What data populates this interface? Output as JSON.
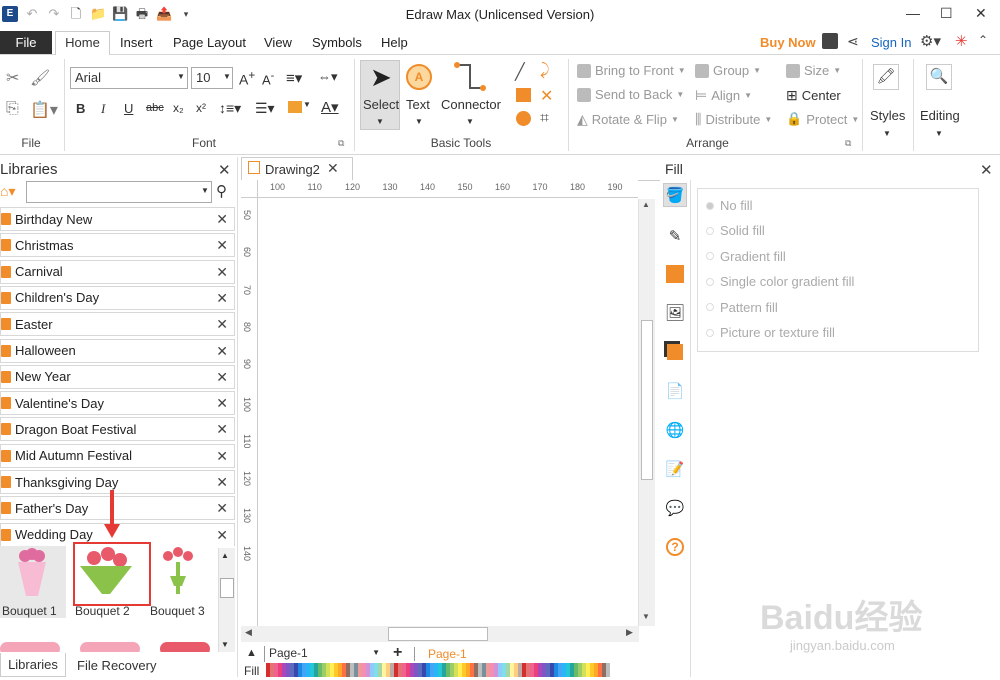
{
  "window": {
    "title": "Edraw Max (Unlicensed Version)",
    "minimize": "—",
    "maximize": "☐",
    "close": "✕"
  },
  "menu": {
    "file": "File",
    "home": "Home",
    "insert": "Insert",
    "page_layout": "Page Layout",
    "view": "View",
    "symbols": "Symbols",
    "help": "Help",
    "buy_now": "Buy Now",
    "sign_in": "Sign In"
  },
  "ribbon": {
    "file_group": "File",
    "font_group": "Font",
    "font_name": "Arial",
    "font_size": "10",
    "basic_tools_group": "Basic Tools",
    "select": "Select",
    "text": "Text",
    "connector": "Connector",
    "arrange_group": "Arrange",
    "bring_to_front": "Bring to Front",
    "send_to_back": "Send to Back",
    "rotate_flip": "Rotate & Flip",
    "group": "Group",
    "align": "Align",
    "distribute": "Distribute",
    "size": "Size",
    "center": "Center",
    "protect": "Protect",
    "styles": "Styles",
    "editing": "Editing"
  },
  "libraries": {
    "title": "Libraries",
    "items": [
      "Birthday New",
      "Christmas",
      "Carnival",
      "Children's Day",
      "Easter",
      "Halloween",
      "New Year",
      "Valentine's Day",
      "Dragon Boat Festival",
      "Mid Autumn Festival",
      "Thanksgiving Day",
      "Father's Day",
      "Wedding Day"
    ],
    "shapes": [
      "Bouquet 1",
      "Bouquet 2",
      "Bouquet 3"
    ],
    "tab_libraries": "Libraries",
    "tab_file_recovery": "File Recovery"
  },
  "document": {
    "tab": "Drawing2",
    "page_select": "Page-1",
    "page_tab": "Page-1",
    "fill_label": "Fill"
  },
  "ruler": {
    "h": [
      "100",
      "110",
      "120",
      "130",
      "140",
      "150",
      "160",
      "170",
      "180",
      "190"
    ],
    "v": [
      "50",
      "60",
      "70",
      "80",
      "90",
      "100",
      "110",
      "120",
      "130",
      "140"
    ]
  },
  "fill_panel": {
    "title": "Fill",
    "options": [
      "No fill",
      "Solid fill",
      "Gradient fill",
      "Single color gradient fill",
      "Pattern fill",
      "Picture or texture fill"
    ]
  },
  "colors": {
    "accent": "#f08c2a",
    "highlight": "#e53935",
    "sign_in": "#1565c0"
  },
  "watermark": {
    "brand": "Baidu经验",
    "url": "jingyan.baidu.com"
  }
}
